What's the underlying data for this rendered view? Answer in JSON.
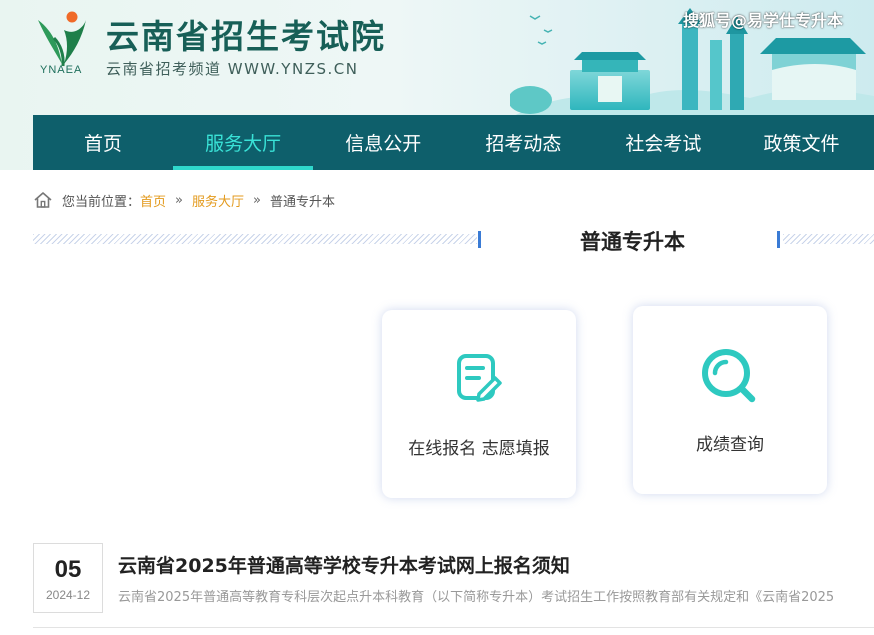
{
  "header": {
    "logo_abbr": "YNAEA",
    "site_title": "云南省招生考试院",
    "site_subtitle": "云南省招考频道 WWW.YNZS.CN",
    "watermark": "搜狐号@易学仕专升本",
    "colors": {
      "brand": "#175f57",
      "logo_orange": "#f06a28",
      "logo_green": "#2e9a5a"
    }
  },
  "nav": {
    "items": [
      {
        "label": "首页"
      },
      {
        "label": "服务大厅",
        "active": true
      },
      {
        "label": "信息公开"
      },
      {
        "label": "招考动态"
      },
      {
        "label": "社会考试"
      },
      {
        "label": "政策文件"
      }
    ],
    "colors": {
      "background": "#0e5f6b",
      "active_text": "#39e2d7",
      "active_underline": "#2fd8cc"
    }
  },
  "breadcrumb": {
    "prefix": "您当前位置：",
    "items": [
      "首页",
      "服务大厅",
      "普通专升本"
    ],
    "separator": "»",
    "home_icon": "home-icon"
  },
  "section": {
    "title": "普通专升本"
  },
  "cards": [
    {
      "label": "在线报名 志愿填报",
      "icon": "form-edit-icon"
    },
    {
      "label": "成绩查询",
      "icon": "search-icon"
    }
  ],
  "news": [
    {
      "day": "05",
      "year_month": "2024-12",
      "title": "云南省2025年普通高等学校专升本考试网上报名须知",
      "summary": "云南省2025年普通高等教育专科层次起点升本科教育（以下简称专升本）考试招生工作按照教育部有关规定和《云南省2025"
    }
  ],
  "accent_color": "#2ec9c0"
}
